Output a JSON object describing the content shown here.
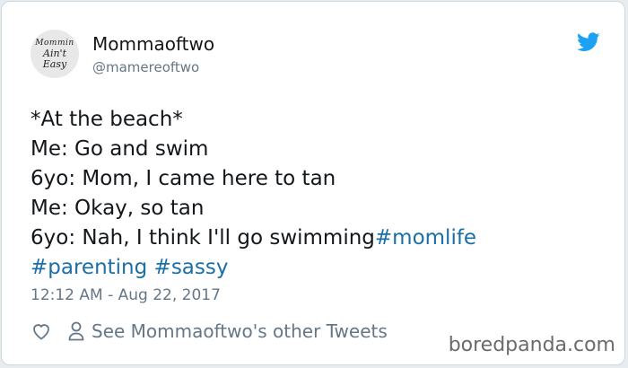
{
  "user": {
    "name": "Mommaoftwo",
    "handle": "@mamereoftwo",
    "avatar_text": [
      "Mommin",
      "Ain't",
      "Easy"
    ]
  },
  "tweet": {
    "lines": [
      "*At the beach*",
      "Me: Go and swim",
      "6yo: Mom, I came here to tan",
      "Me: Okay, so tan",
      "6yo: Nah, I think I'll go swimming"
    ],
    "hashtags": [
      "#momlife",
      "#parenting",
      "#sassy"
    ],
    "timestamp": "12:12 AM - Aug 22, 2017"
  },
  "actions": {
    "other_tweets_label": "See Mommaoftwo's other Tweets"
  },
  "watermark": "boredpanda.com",
  "colors": {
    "twitter_blue": "#1da1f2",
    "hashtag": "#1b6fa8",
    "secondary_text": "#657786",
    "primary_text": "#14171a"
  },
  "icons": [
    "twitter-bird-icon",
    "heart-icon",
    "person-icon"
  ]
}
